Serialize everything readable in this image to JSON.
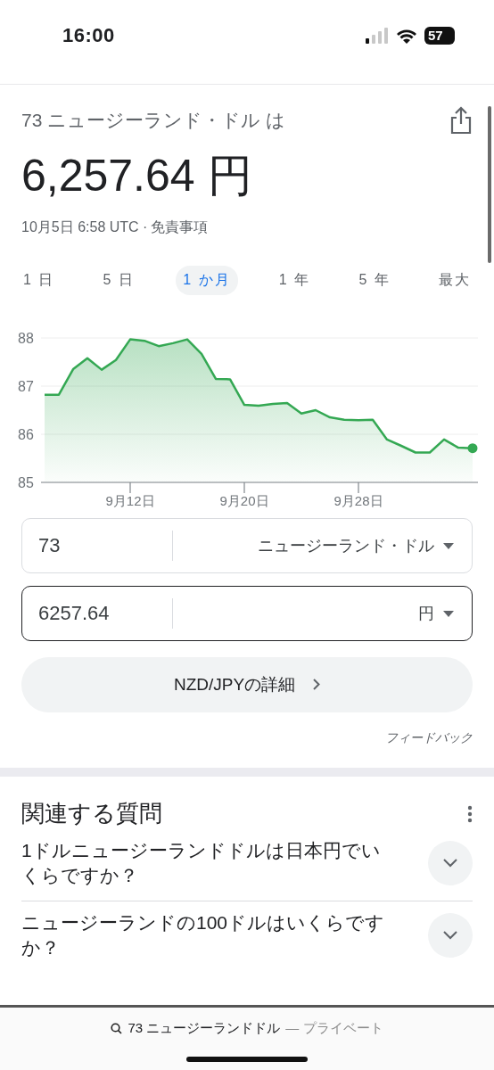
{
  "status_bar": {
    "time": "16:00",
    "battery": "57"
  },
  "result": {
    "query": "73 ニュージーランド・ドル は",
    "value": "6,257.64 円",
    "timestamp": "10月5日 6:58 UTC ·",
    "disclaimer": "免責事項"
  },
  "tabs": [
    {
      "label": "1 日",
      "selected": false
    },
    {
      "label": "5 日",
      "selected": false
    },
    {
      "label": "1 か月",
      "selected": true
    },
    {
      "label": "1 年",
      "selected": false
    },
    {
      "label": "5 年",
      "selected": false
    },
    {
      "label": "最大",
      "selected": false
    }
  ],
  "chart_data": {
    "type": "area",
    "categories": [
      null,
      null,
      null,
      null,
      null,
      null,
      "9月12日",
      null,
      null,
      null,
      null,
      null,
      null,
      null,
      "9月20日",
      null,
      null,
      null,
      null,
      null,
      null,
      null,
      "9月28日",
      null,
      null,
      null,
      null,
      null,
      null,
      null,
      null
    ],
    "series": [
      {
        "color": "#34a853",
        "values": [
          86.82,
          86.82,
          87.35,
          87.58,
          87.34,
          87.54,
          87.97,
          87.94,
          87.83,
          87.89,
          87.97,
          87.67,
          87.15,
          87.14,
          86.61,
          86.59,
          86.63,
          86.65,
          86.43,
          86.5,
          86.35,
          86.3,
          86.29,
          86.3,
          85.89,
          85.76,
          85.62,
          85.62,
          85.89,
          85.72,
          85.71
        ]
      }
    ],
    "ylim": [
      85,
      88
    ],
    "grid": true,
    "yticks": [
      85,
      86,
      87,
      88
    ]
  },
  "converter": [
    {
      "value": "73",
      "currency": "ニュージーランド・ドル",
      "focused": false
    },
    {
      "value": "6257.64",
      "currency": "円",
      "focused": true
    }
  ],
  "details_button": "NZD/JPYの詳細",
  "feedback": "フィードバック",
  "related": {
    "title": "関連する質問",
    "questions": [
      {
        "text": "1ドルニュージーランドドルは日本円でいくらですか？",
        "expanded": false
      },
      {
        "text": "ニュージーランドの100ドルはいくらですか？",
        "expanded": false
      }
    ]
  },
  "address_bar": {
    "query": "73 ニュージーランドドル",
    "mode": "— プライベート"
  }
}
